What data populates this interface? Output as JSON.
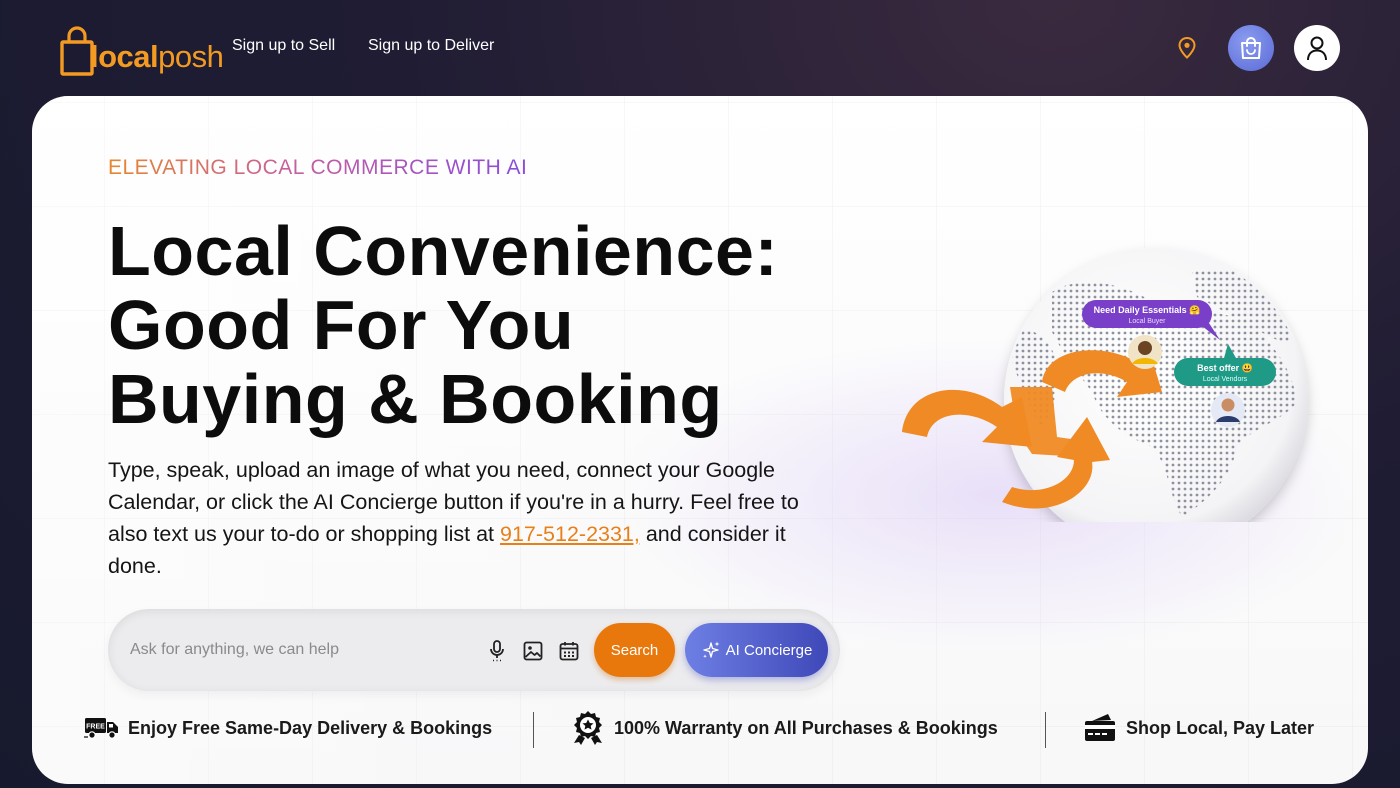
{
  "brand": {
    "logo_local": "local",
    "logo_posh": "posh",
    "accent": "#f39a22"
  },
  "nav": {
    "sell": "Sign up to Sell",
    "deliver": "Sign up to Deliver"
  },
  "header_icons": [
    "location-pin-icon",
    "shopping-bag-icon",
    "user-icon"
  ],
  "hero": {
    "eyebrow": "ELEVATING LOCAL COMMERCE WITH AI",
    "headline": [
      "Local Convenience:",
      "Good For You",
      "Buying & Booking"
    ],
    "desc_before": "Type, speak, upload an image of what you need, connect your Google Calendar, or click the AI Concierge button if you're in a hurry. Feel free to also text us your to-do or shopping list at ",
    "phone": "917-512-2331,",
    "desc_after": " and consider it done."
  },
  "search": {
    "placeholder": "Ask for anything, we can help",
    "value": "",
    "search_label": "Search",
    "ai_label": "AI Concierge",
    "search_color": "#e8780c",
    "ai_color": "#5560cc"
  },
  "illustration": {
    "bubble_buyer": {
      "title": "Need Daily Essentials 🤗",
      "sub": "Local Buyer"
    },
    "bubble_vendor": {
      "title": "Best offer 😃",
      "sub": "Local Vendors"
    }
  },
  "features": [
    {
      "icon": "free-delivery-truck-icon",
      "text": "Enjoy Free Same-Day Delivery & Bookings",
      "badge": "FREE"
    },
    {
      "icon": "warranty-award-icon",
      "text": "100% Warranty on All Purchases & Bookings"
    },
    {
      "icon": "credit-card-icon",
      "text": "Shop Local, Pay Later"
    }
  ]
}
